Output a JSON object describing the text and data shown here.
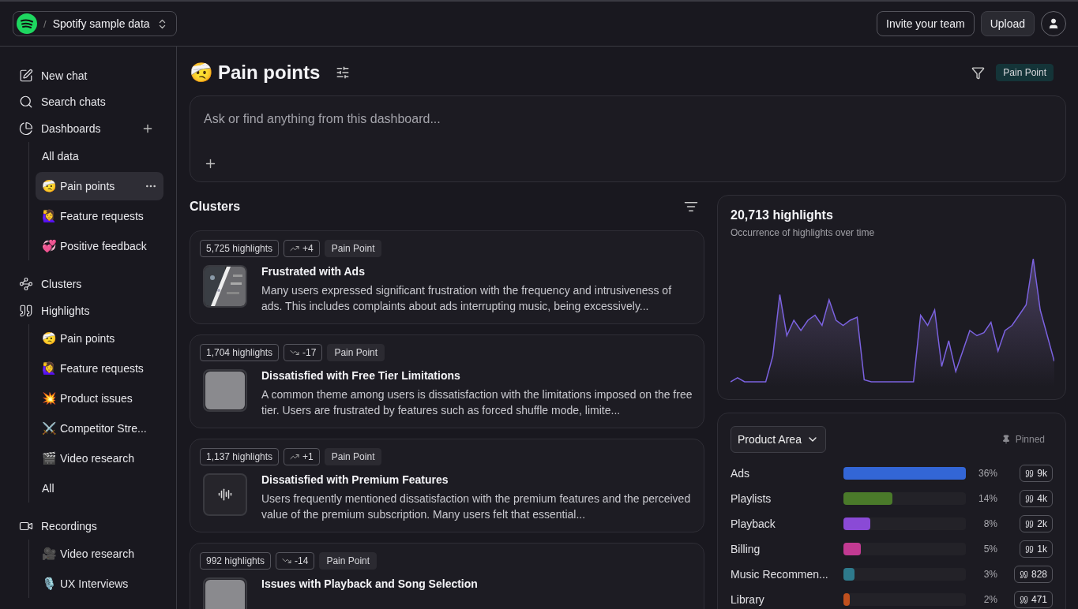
{
  "workspace": {
    "separator": "/",
    "name": "Spotify sample data"
  },
  "header_actions": {
    "invite": "Invite your team",
    "upload": "Upload"
  },
  "sidebar": {
    "items": [
      {
        "kind": "new-chat",
        "label": "New chat",
        "selected": false
      },
      {
        "kind": "search",
        "label": "Search chats",
        "selected": false
      },
      {
        "kind": "dashboards",
        "label": "Dashboards",
        "selected": false,
        "add": true,
        "children": [
          {
            "label": "All data",
            "selected": false
          },
          {
            "emoji": "🤕",
            "label": "Pain points",
            "selected": true
          },
          {
            "emoji": "🙋‍♀️",
            "label": "Feature requests",
            "selected": false
          },
          {
            "emoji": "💞",
            "label": "Positive feedback",
            "selected": false
          }
        ]
      },
      {
        "kind": "clusters",
        "label": "Clusters",
        "selected": false
      },
      {
        "kind": "highlights",
        "label": "Highlights",
        "selected": false,
        "children": [
          {
            "emoji": "🤕",
            "label": "Pain points",
            "selected": false
          },
          {
            "emoji": "🙋‍♀️",
            "label": "Feature requests",
            "selected": false
          },
          {
            "emoji": "💥",
            "label": "Product issues",
            "selected": false
          },
          {
            "emoji": "⚔️",
            "label": "Competitor Stre...",
            "selected": false
          },
          {
            "emoji": "🎬",
            "label": "Video research",
            "selected": false
          },
          {
            "label": "All",
            "selected": false
          }
        ]
      },
      {
        "kind": "recordings",
        "label": "Recordings",
        "selected": false,
        "children": [
          {
            "emoji": "🎥",
            "label": "Video research",
            "selected": false
          },
          {
            "emoji": "🎙️",
            "label": "UX Interviews",
            "selected": false
          }
        ]
      }
    ]
  },
  "page": {
    "emoji": "🤕",
    "title": "Pain points",
    "filter_tag": "Pain Point"
  },
  "ask": {
    "placeholder": "Ask or find anything from this dashboard..."
  },
  "clusters": {
    "title": "Clusters",
    "items": [
      {
        "count": "5,725 highlights",
        "trend": {
          "kind": "up",
          "change": "+4"
        },
        "tag": "Pain Point",
        "title": "Frustrated with Ads",
        "text": "Many users expressed significant frustration with the frequency and intrusiveness of ads. This includes complaints about ads interrupting music, being excessively..."
      },
      {
        "count": "1,704 highlights",
        "trend": {
          "kind": "down",
          "change": "-17"
        },
        "tag": "Pain Point",
        "thumb": {
          "kind": "blank"
        },
        "title": "Dissatisfied with Free Tier Limitations",
        "text": "A common theme among users is dissatisfaction with the limitations imposed on the free tier. Users are frustrated by features such as forced shuffle mode, limite..."
      },
      {
        "count": "1,137 highlights",
        "trend": {
          "kind": "up",
          "change": "+1"
        },
        "tag": "Pain Point",
        "thumb": {
          "kind": "audio"
        },
        "title": "Dissatisfied with Premium Features",
        "text": "Users frequently mentioned dissatisfaction with the premium features and the perceived value of the premium subscription. Many users felt that essential..."
      },
      {
        "count": "992 highlights",
        "trend": {
          "kind": "down",
          "change": "-14"
        },
        "tag": "Pain Point",
        "thumb": {
          "kind": "blank"
        },
        "title": "Issues with Playback and Song Selection"
      }
    ]
  },
  "overview": {
    "title": "20,713 highlights",
    "subtitle": "Occurrence of highlights over time"
  },
  "breakdown": {
    "dropdown": "Product Area",
    "pinned": "Pinned",
    "rows": [
      {
        "label": "Ads",
        "level": 1.0,
        "color": "#3366d6",
        "percent": "36%",
        "count": "9k"
      },
      {
        "label": "Playlists",
        "level": 0.4,
        "color": "#4a7a2a",
        "percent": "14%",
        "count": "4k"
      },
      {
        "label": "Playback",
        "level": 0.22,
        "color": "#8a4ad6",
        "percent": "8%",
        "count": "2k"
      },
      {
        "label": "Billing",
        "level": 0.14,
        "color": "#c23a92",
        "percent": "5%",
        "count": "1k"
      },
      {
        "label": "Music Recommen...",
        "level": 0.09,
        "color": "#2e7a8c",
        "percent": "3%",
        "count": "828"
      },
      {
        "label": "Library",
        "level": 0.05,
        "color": "#c0501e",
        "percent": "2%",
        "count": "471"
      }
    ]
  }
}
